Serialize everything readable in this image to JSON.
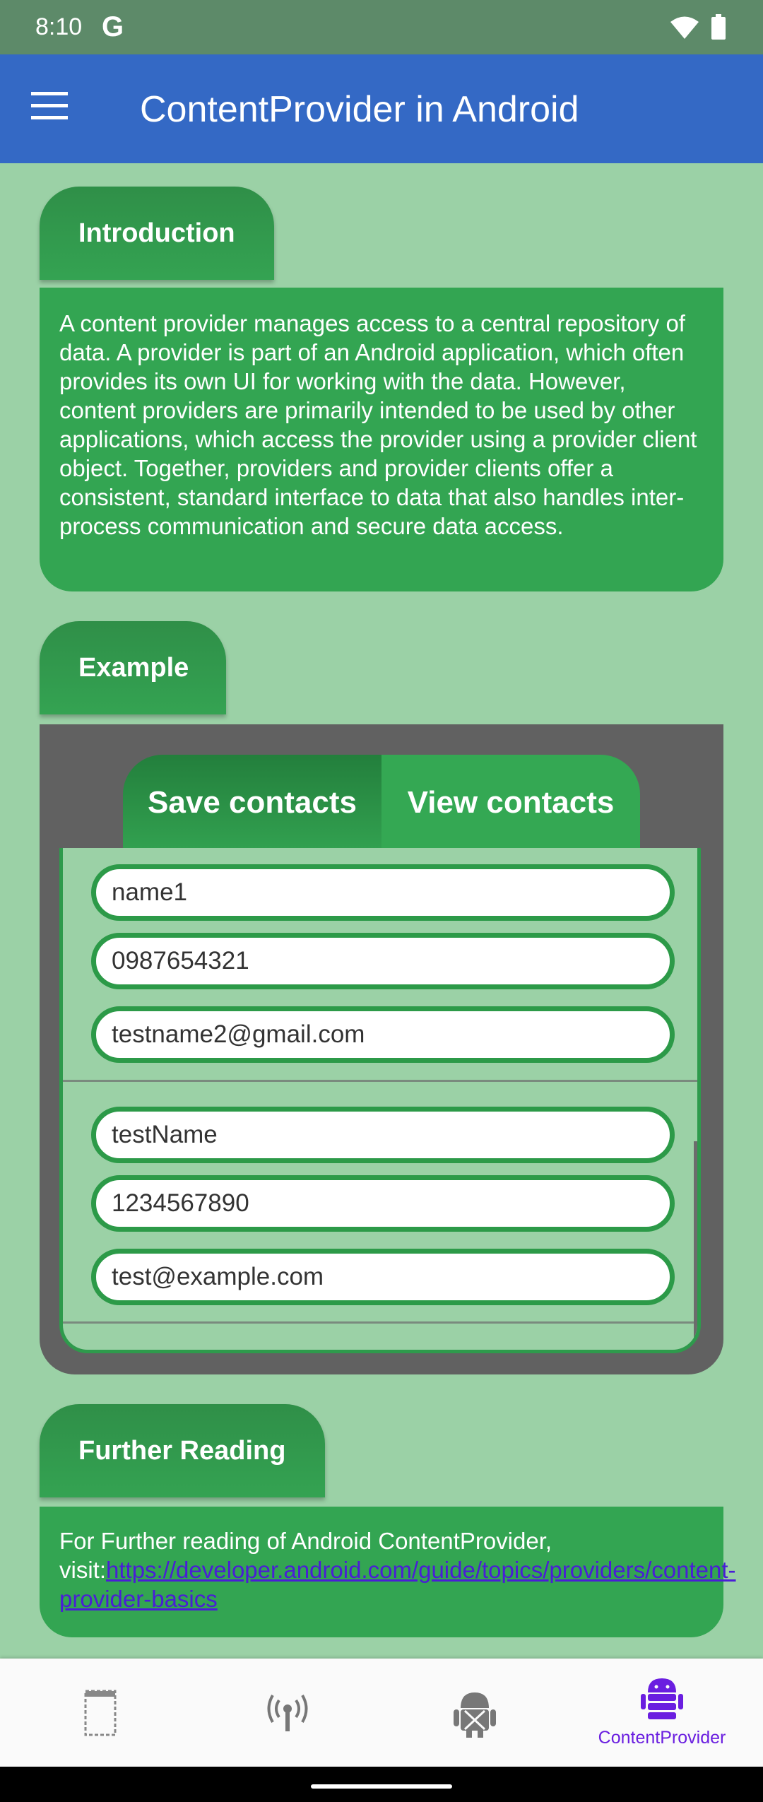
{
  "status_bar": {
    "time": "8:10",
    "g_logo": "G"
  },
  "app_bar": {
    "title": "ContentProvider in Android",
    "menu_icon": "menu-icon"
  },
  "introduction": {
    "header": "Introduction",
    "text": "A content provider manages access to a central repository of data. A provider is part of an Android application, which often provides its own UI for working with the data. However, content providers are primarily intended to be used by other applications, which access the provider using a provider client object. Together, providers and provider clients offer a consistent, standard interface to data that also handles inter-process communication and secure data access."
  },
  "example": {
    "header": "Example",
    "tabs": [
      {
        "label": "Save contacts"
      },
      {
        "label": "View contacts"
      }
    ],
    "contacts": [
      {
        "name": "name1",
        "phone": "0987654321",
        "email": "testname2@gmail.com"
      },
      {
        "name": "testName",
        "phone": "1234567890",
        "email": "test@example.com"
      }
    ]
  },
  "further_reading": {
    "header": "Further Reading",
    "text": "For Further reading of Android ContentProvider, visit:",
    "link": "https://developer.android.com/guide/topics/providers/content-provider-basics"
  },
  "bottom_nav": {
    "items": [
      {
        "icon": "layout-icon",
        "label": ""
      },
      {
        "icon": "antenna-icon",
        "label": ""
      },
      {
        "icon": "android-broken-icon",
        "label": ""
      },
      {
        "icon": "android-database-icon",
        "label": "ContentProvider",
        "selected": true
      }
    ]
  },
  "colors": {
    "app_bar": "#3469c5",
    "accent_green": "#34a853",
    "background": "#9bd1a6",
    "selected_nav": "#6a1ee0"
  }
}
